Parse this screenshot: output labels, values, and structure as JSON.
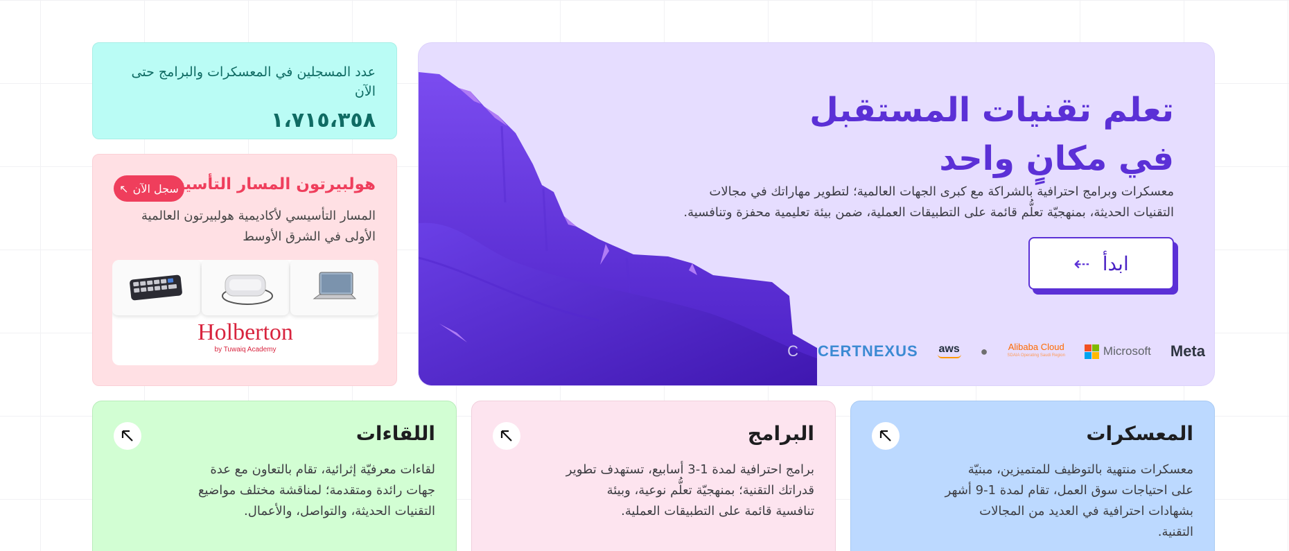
{
  "hero": {
    "title_line1": "تعلم تقنيات المستقبل",
    "title_line2": "في مكانٍ واحد",
    "description": "معسكرات وبرامج احترافية بالشراكة مع كبرى الجهات العالمية؛ لتطوير مهاراتك في مجالات التقنيات الحديثة، بمنهجيّة تعلُّم قائمة على التطبيقات العملية، ضمن بيئة تعليمية محفزة وتنافسية.",
    "cta_label": "ابدأ",
    "cta_icon": "arrow-left-icon",
    "partners": {
      "meta": "Meta",
      "microsoft": "Microsoft",
      "alibaba": "Alibaba Cloud",
      "alibaba_sub": "SDAIA Operating Saudi Region",
      "aws": "aws",
      "certnexus": "CERTNEXUS"
    },
    "colors": {
      "bg": "#e6ddff",
      "accent": "#5b30d6"
    }
  },
  "counter": {
    "label": "عدد المسجلين في المعسكرات والبرامج حتى الآن",
    "value": "١،٧١٥،٣٥٨"
  },
  "holberton": {
    "title": "هولبيرتون المسار التأسيسي",
    "badge": "سجل الآن",
    "description": "المسار التأسيسي لأكاديمية هولبيرتون العالمية الأولى في الشرق الأوسط",
    "logo": "Holberton",
    "logo_sub": "by Tuwaiq Academy"
  },
  "cards": [
    {
      "title": "المعسكرات",
      "description": "معسكرات منتهية بالتوظيف للمتميزين، مبنيّة على احتياجات سوق العمل، تقام لمدة 1-9 أشهر بشهادات احترافية في العديد من المجالات التقنية."
    },
    {
      "title": "البرامج",
      "description": "برامج احترافية لمدة 1-3 أسابيع، تستهدف تطوير قدراتك التقنية؛ بمنهجيّة تعلُّم نوعية، وبيئة تنافسية قائمة على التطبيقات العملية."
    },
    {
      "title": "اللقاءات",
      "description": "لقاءات معرفيّة إثرائية، تقام بالتعاون مع عدة جهات رائدة ومتقدمة؛ لمناقشة مختلف مواضيع التقنيات الحديثة، والتواصل، والأعمال."
    }
  ]
}
